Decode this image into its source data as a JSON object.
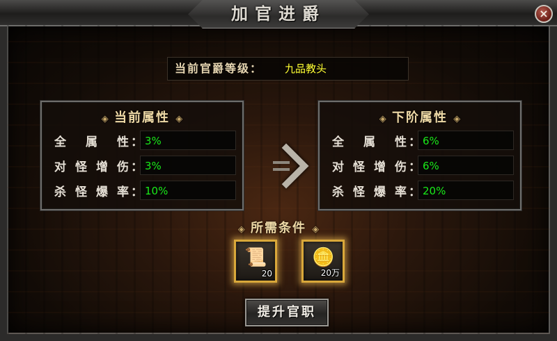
{
  "window": {
    "title": "加官进爵",
    "close_symbol": "×",
    "close_icon": "close-icon"
  },
  "rank": {
    "label": "当前官爵等级：",
    "value": "九品教头"
  },
  "ornament": {
    "left": "◈",
    "right": "◈"
  },
  "current_attributes": {
    "header": "当前属性",
    "rows": [
      {
        "label": "全 属 性",
        "value": "3%"
      },
      {
        "label": "对怪增伤",
        "value": "3%"
      },
      {
        "label": "杀怪爆率",
        "value": "10%"
      }
    ]
  },
  "next_attributes": {
    "header": "下阶属性",
    "rows": [
      {
        "label": "全 属 性",
        "value": "6%"
      },
      {
        "label": "对怪增伤",
        "value": "6%"
      },
      {
        "label": "杀怪爆率",
        "value": "20%"
      }
    ]
  },
  "colon": "：",
  "arrow_icon": "double-chevron-right-icon",
  "requirements": {
    "header": "所需条件",
    "items": [
      {
        "icon": "scroll-icon",
        "glyph": "📜",
        "count": "20"
      },
      {
        "icon": "gold-coins-icon",
        "glyph": "🪙",
        "count": "20万"
      }
    ]
  },
  "promote_button": "提升官职",
  "colors": {
    "value_green": "#19ea19",
    "rank_yellow": "#ffff33",
    "header_gold": "#eed9a6",
    "slot_border": "#d9a83a"
  }
}
